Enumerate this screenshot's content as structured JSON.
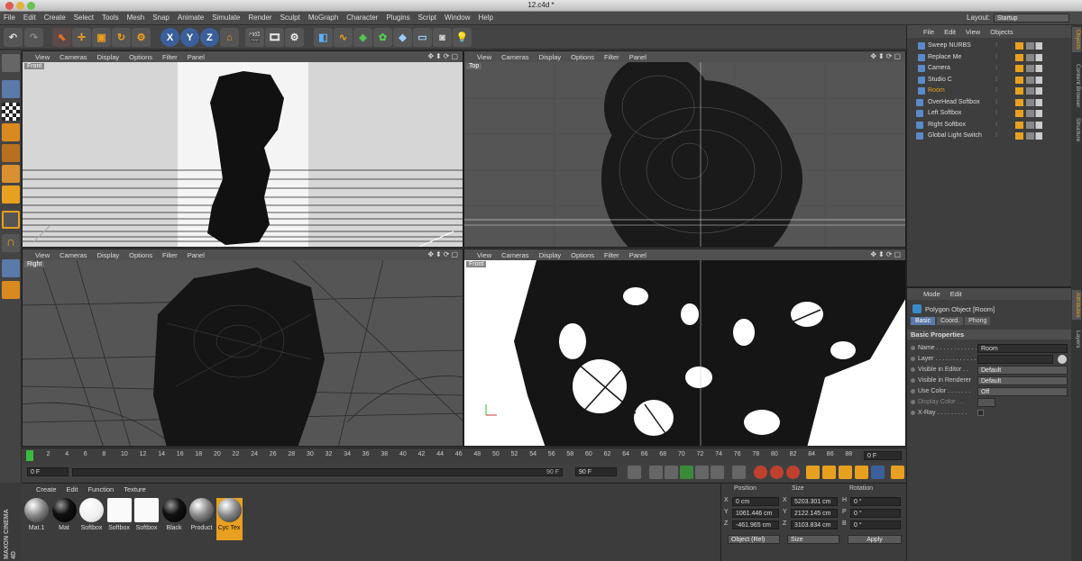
{
  "window": {
    "title": "12.c4d *"
  },
  "menubar": {
    "items": [
      "File",
      "Edit",
      "Create",
      "Select",
      "Tools",
      "Mesh",
      "Snap",
      "Animate",
      "Simulate",
      "Render",
      "Sculpt",
      "MoGraph",
      "Character",
      "Plugins",
      "Script",
      "Window",
      "Help"
    ],
    "layout_label": "Layout:",
    "layout_value": "Startup"
  },
  "toolbar": {
    "axes": [
      "X",
      "Y",
      "Z"
    ]
  },
  "viewports": [
    {
      "menus": [
        "View",
        "Cameras",
        "Display",
        "Options",
        "Filter",
        "Panel"
      ],
      "label": "Front"
    },
    {
      "menus": [
        "View",
        "Cameras",
        "Display",
        "Options",
        "Filter",
        "Panel"
      ],
      "label": "Top"
    },
    {
      "menus": [
        "View",
        "Cameras",
        "Display",
        "Options",
        "Filter",
        "Panel"
      ],
      "label": "Right"
    },
    {
      "menus": [
        "View",
        "Cameras",
        "Display",
        "Options",
        "Filter",
        "Panel"
      ],
      "label": "Front"
    }
  ],
  "timeline": {
    "ticks": [
      "0",
      "2",
      "4",
      "6",
      "8",
      "10",
      "12",
      "14",
      "16",
      "18",
      "20",
      "22",
      "24",
      "26",
      "28",
      "30",
      "32",
      "34",
      "36",
      "38",
      "40",
      "42",
      "44",
      "46",
      "48",
      "50",
      "52",
      "54",
      "56",
      "58",
      "60",
      "62",
      "64",
      "66",
      "68",
      "70",
      "72",
      "74",
      "76",
      "78",
      "80",
      "82",
      "84",
      "86",
      "88",
      "90"
    ],
    "current_frame": "0 F",
    "start_field": "0 F",
    "end_field": "90 F",
    "end_field2": "90 F"
  },
  "materials": {
    "menus": [
      "Create",
      "Edit",
      "Function",
      "Texture"
    ],
    "items": [
      {
        "name": "Mat.1",
        "type": "grey"
      },
      {
        "name": "Mat",
        "type": "black"
      },
      {
        "name": "Softbox",
        "type": "white"
      },
      {
        "name": "Softbox",
        "type": "whitesq"
      },
      {
        "name": "Softbox",
        "type": "whitesq"
      },
      {
        "name": "Black",
        "type": "black"
      },
      {
        "name": "Product",
        "type": "grey"
      },
      {
        "name": "Cyc Tex",
        "type": "grey",
        "selected": true
      }
    ]
  },
  "coordinates": {
    "headers": [
      "Position",
      "Size",
      "Rotation"
    ],
    "rows": [
      {
        "axis": "X",
        "pos": "0 cm",
        "size_axis": "X",
        "size": "5203.301 cm",
        "rot_axis": "H",
        "rot": "0 °"
      },
      {
        "axis": "Y",
        "pos": "1061.446 cm",
        "size_axis": "Y",
        "size": "2122.145 cm",
        "rot_axis": "P",
        "rot": "0 °"
      },
      {
        "axis": "Z",
        "pos": "-461.965 cm",
        "size_axis": "Z",
        "size": "3103.834 cm",
        "rot_axis": "B",
        "rot": "0 °"
      }
    ],
    "mode": "Object (Rel)",
    "size_mode": "Size",
    "apply": "Apply"
  },
  "brand": {
    "line1": "MAXON",
    "line2": "CINEMA 4D"
  },
  "objects": {
    "menus": [
      "File",
      "Edit",
      "View",
      "Objects"
    ],
    "items": [
      {
        "name": "Sweep NURBS",
        "indent": 1,
        "active": false
      },
      {
        "name": "Replace Me",
        "indent": 1,
        "active": false
      },
      {
        "name": "Camera",
        "indent": 1,
        "active": false
      },
      {
        "name": "Studio C",
        "indent": 1,
        "active": false
      },
      {
        "name": "Room",
        "indent": 1,
        "active": true
      },
      {
        "name": "OverHead Softbox",
        "indent": 0,
        "active": false
      },
      {
        "name": "Left Softbox",
        "indent": 0,
        "active": false
      },
      {
        "name": "Right Softbox",
        "indent": 0,
        "active": false
      },
      {
        "name": "Global Light Switch",
        "indent": 0,
        "active": false
      }
    ]
  },
  "attributes": {
    "menus": [
      "Mode",
      "Edit"
    ],
    "object_title": "Polygon Object [Room]",
    "tabs": [
      "Basic",
      "Coord.",
      "Phong"
    ],
    "section": "Basic Properties",
    "fields": [
      {
        "label": "Name . . . . . . . . . . . . .",
        "value": "Room",
        "kind": "text"
      },
      {
        "label": "Layer . . . . . . . . . . . . .",
        "value": "",
        "kind": "layer"
      },
      {
        "label": "Visible in Editor . .",
        "value": "Default",
        "kind": "dropdown"
      },
      {
        "label": "Visible in Renderer",
        "value": "Default",
        "kind": "dropdown"
      },
      {
        "label": "Use Color . . . . . . .",
        "value": "Off",
        "kind": "dropdown"
      },
      {
        "label": "Display Color . .",
        "value": "",
        "kind": "color"
      },
      {
        "label": "X-Ray . . . . . . . . .",
        "value": "",
        "kind": "check"
      }
    ]
  },
  "right_tabs": [
    "Objects",
    "Content Browser",
    "Structure",
    "Attributes",
    "Layers"
  ],
  "colors": {
    "panel": "#3c3c3c",
    "accent_orange": "#e8a020",
    "accent_blue": "#3a5f9a"
  }
}
